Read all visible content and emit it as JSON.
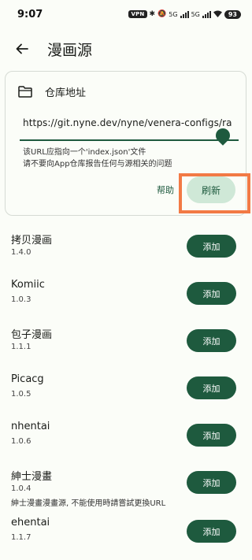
{
  "status_bar": {
    "time": "9:07",
    "vpn": "VPN",
    "net1": "5G",
    "net2": "5G",
    "battery": "93"
  },
  "app_bar": {
    "back_icon": "arrow-left-icon",
    "title": "漫画源"
  },
  "repo_card": {
    "folder_icon": "folder-icon",
    "label": "仓库地址",
    "url_value": "https://git.nyne.dev/nyne/venera-configs/ra",
    "hint_line1": "该URL应指向一个'index.json'文件",
    "hint_line2": "请不要向App仓库报告任何与源相关的问题",
    "help_label": "帮助",
    "refresh_label": "刷新"
  },
  "sources": [
    {
      "name": "拷贝漫画",
      "version": "1.4.0",
      "action": "添加"
    },
    {
      "name": "Komiic",
      "version": "1.0.3",
      "action": "添加"
    },
    {
      "name": "包子漫画",
      "version": "1.1.1",
      "action": "添加"
    },
    {
      "name": "Picacg",
      "version": "1.0.5",
      "action": "添加"
    },
    {
      "name": "nhentai",
      "version": "1.0.6",
      "action": "添加"
    },
    {
      "name": "紳士漫畫",
      "version": "1.0.4",
      "description": "紳士漫畫漫畫源, 不能使用時請嘗試更換URL",
      "action": "添加"
    },
    {
      "name": "ehentai",
      "version": "1.1.7",
      "action": "添加"
    }
  ],
  "colors": {
    "primary": "#1e5a3e",
    "primary_container": "#cfe8d7",
    "highlight": "#f27a45",
    "background": "#fbfdf8"
  }
}
